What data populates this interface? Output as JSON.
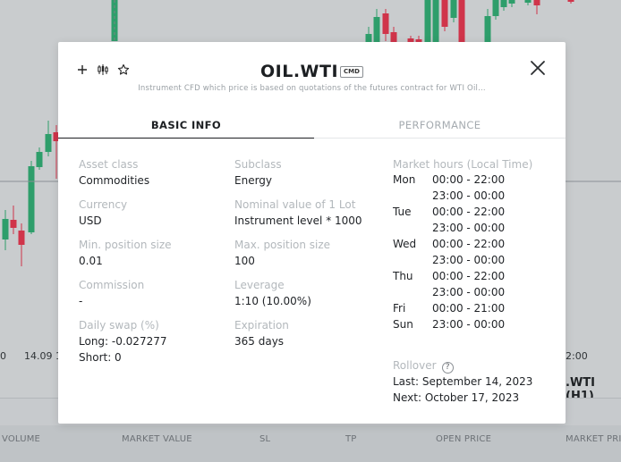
{
  "background": {
    "axis_dates": [
      "0",
      "14.09 1",
      "2:00"
    ],
    "symbol_tag": ".WTI (H1)",
    "table_columns": [
      "VOLUME",
      "MARKET VALUE",
      "SL",
      "TP",
      "OPEN PRICE",
      "MARKET PRIC"
    ]
  },
  "modal": {
    "title": "OIL.WTI",
    "badge": "CMD",
    "subtitle": "Instrument CFD which price is based on quotations of the futures contract for WTI Oil...",
    "icons": [
      "plus-icon",
      "candlestick-icon",
      "star-icon",
      "close-icon"
    ],
    "tabs": {
      "basic": "BASIC INFO",
      "performance": "PERFORMANCE"
    },
    "fields": {
      "asset_class": {
        "label": "Asset class",
        "value": "Commodities"
      },
      "subclass": {
        "label": "Subclass",
        "value": "Energy"
      },
      "currency": {
        "label": "Currency",
        "value": "USD"
      },
      "nominal": {
        "label": "Nominal value of 1 Lot",
        "value": "Instrument level * 1000"
      },
      "min_position": {
        "label": "Min. position size",
        "value": "0.01"
      },
      "max_position": {
        "label": "Max. position size",
        "value": "100"
      },
      "commission": {
        "label": "Commission",
        "value": "-"
      },
      "leverage": {
        "label": "Leverage",
        "value": "1:10 (10.00%)"
      },
      "daily_swap": {
        "label": "Daily swap (%)",
        "long": "Long: -0.027277",
        "short": "Short: 0"
      },
      "expiration": {
        "label": "Expiration",
        "value": "365 days"
      }
    },
    "market_hours": {
      "label": "Market hours (Local Time)",
      "rows": [
        {
          "day": "Mon",
          "time": "00:00 - 22:00"
        },
        {
          "day": "",
          "time": "23:00 - 00:00"
        },
        {
          "day": "Tue",
          "time": "00:00 - 22:00"
        },
        {
          "day": "",
          "time": "23:00 - 00:00"
        },
        {
          "day": "Wed",
          "time": "00:00 - 22:00"
        },
        {
          "day": "",
          "time": "23:00 - 00:00"
        },
        {
          "day": "Thu",
          "time": "00:00 - 22:00"
        },
        {
          "day": "",
          "time": "23:00 - 00:00"
        },
        {
          "day": "Fri",
          "time": "00:00 - 21:00"
        },
        {
          "day": "Sun",
          "time": "23:00 - 00:00"
        }
      ]
    },
    "rollover": {
      "label": "Rollover",
      "help_icon": "?",
      "last": "Last: September 14, 2023",
      "next": "Next: October 17, 2023"
    }
  },
  "colors": {
    "bull": "#2e9e6b",
    "bear": "#d0344a",
    "accent": "#1c1f22",
    "muted": "#b3b8bc"
  }
}
